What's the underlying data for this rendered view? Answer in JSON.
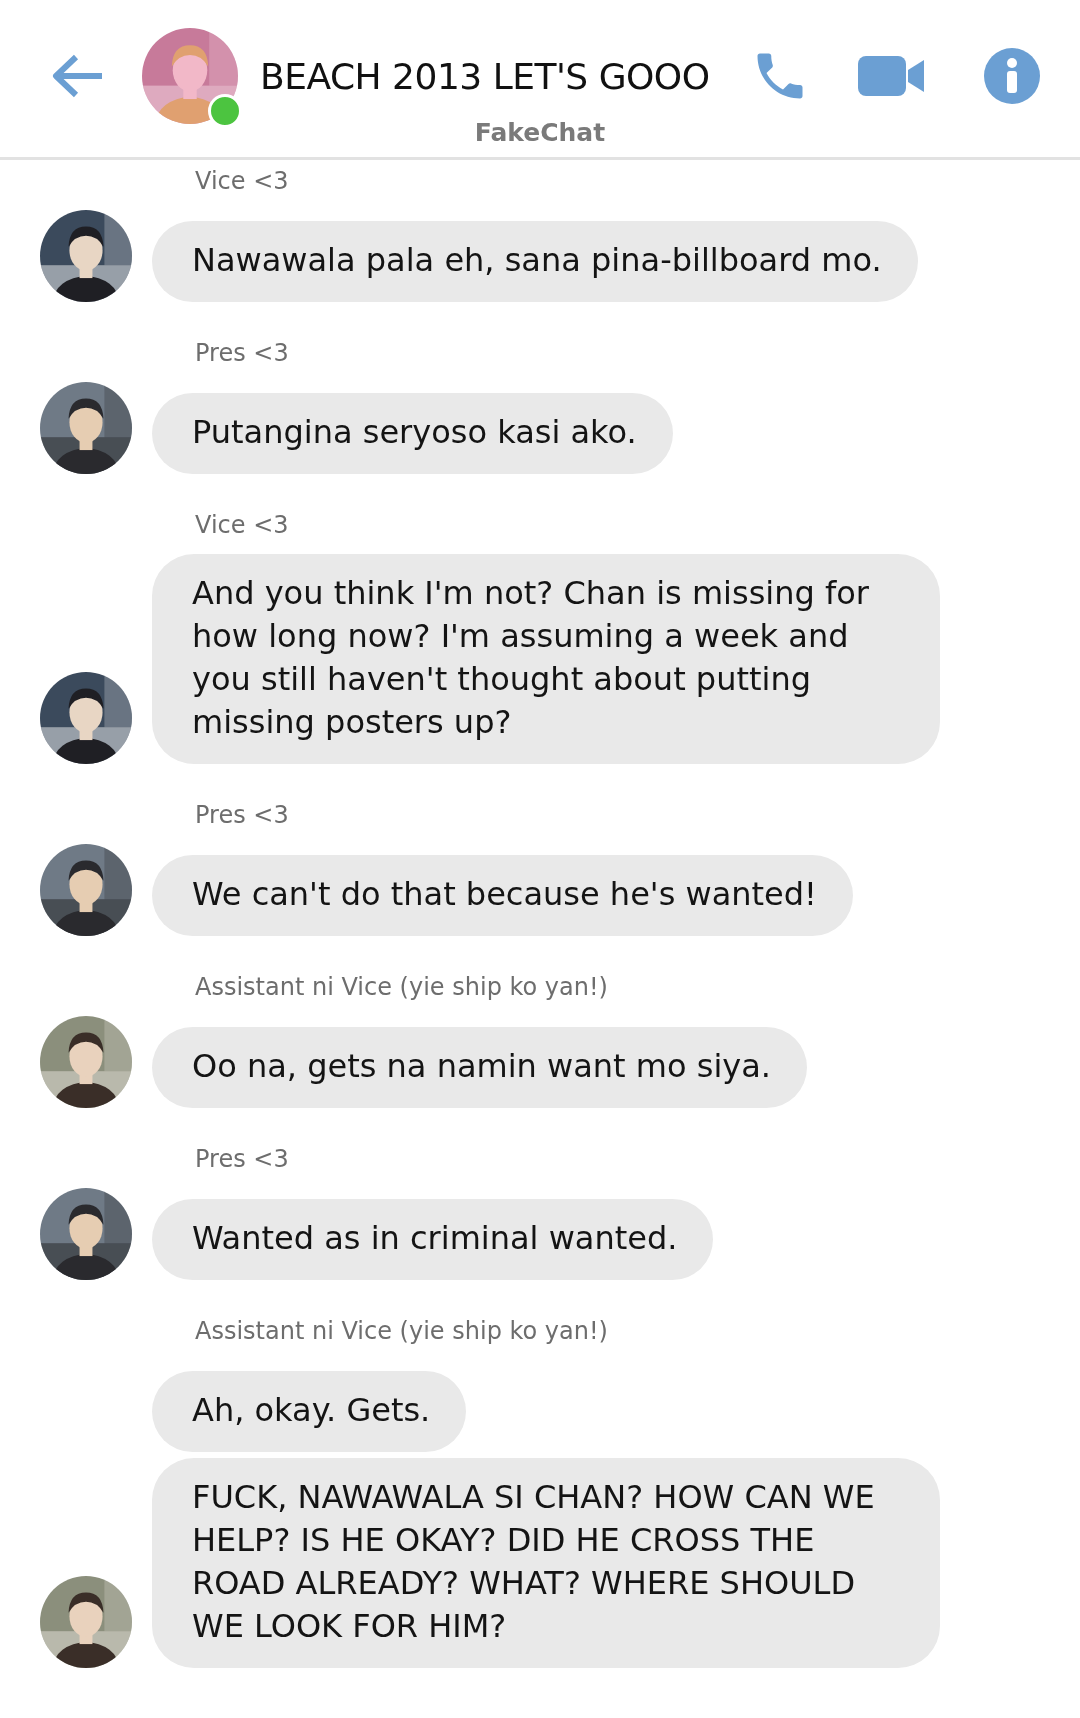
{
  "header": {
    "title": "BEACH 2013 LET'S GOOO",
    "online": true,
    "app_name": "FakeChat"
  },
  "messages": [
    {
      "sender": "Vice <3",
      "text": "Nawawala pala eh, sana pina-billboard mo.",
      "avatar": true
    },
    {
      "sender": "Pres <3",
      "text": "Putangina seryoso kasi ako.",
      "avatar": true
    },
    {
      "sender": "Vice <3",
      "text": "And you think I'm not? Chan is missing for how long now? I'm assuming a week and you still haven't thought about putting missing posters up?",
      "avatar": true
    },
    {
      "sender": "Pres <3",
      "text": "We can't do that because he's wanted!",
      "avatar": true
    },
    {
      "sender": "Assistant ni Vice (yie ship ko yan!)",
      "text": "Oo na, gets na namin want mo siya.",
      "avatar": true
    },
    {
      "sender": "Pres <3",
      "text": "Wanted as in criminal wanted.",
      "avatar": true
    },
    {
      "sender": "Assistant ni Vice (yie ship ko yan!)",
      "text": "Ah, okay. Gets.",
      "avatar": false
    },
    {
      "text": "FUCK, NAWAWALA SI CHAN? HOW CAN WE HELP? IS HE OKAY? DID HE CROSS THE ROAD ALREADY? WHAT? WHERE SHOULD WE LOOK FOR HIM?",
      "avatar": true
    }
  ]
}
